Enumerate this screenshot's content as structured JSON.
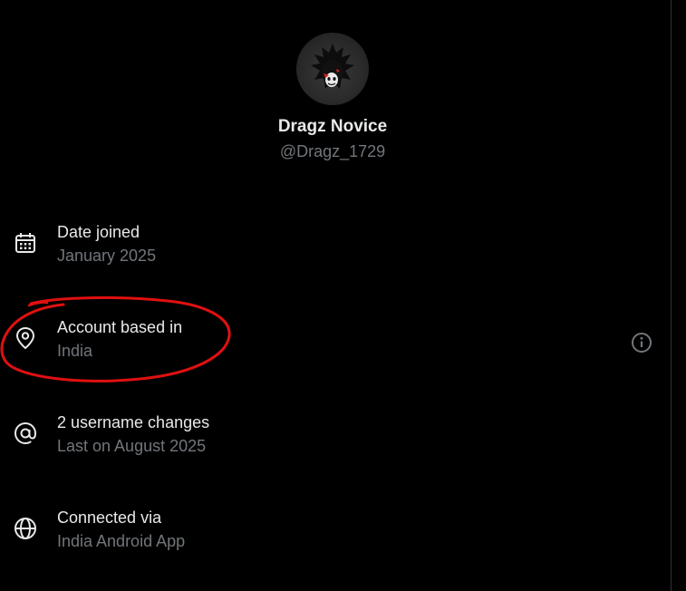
{
  "profile": {
    "display_name": "Dragz Novice",
    "handle": "@Dragz_1729"
  },
  "rows": [
    {
      "icon": "calendar-icon",
      "title": "Date joined",
      "subtitle": "January 2025"
    },
    {
      "icon": "location-pin-icon",
      "title": "Account based in",
      "subtitle": "India"
    },
    {
      "icon": "at-sign-icon",
      "title": "2 username changes",
      "subtitle": "Last on August 2025"
    },
    {
      "icon": "globe-icon",
      "title": "Connected via",
      "subtitle": "India Android App"
    }
  ],
  "colors": {
    "background": "#000000",
    "primary_text": "#e7e9ea",
    "secondary_text": "#71767b",
    "annotation": "#e01010"
  }
}
